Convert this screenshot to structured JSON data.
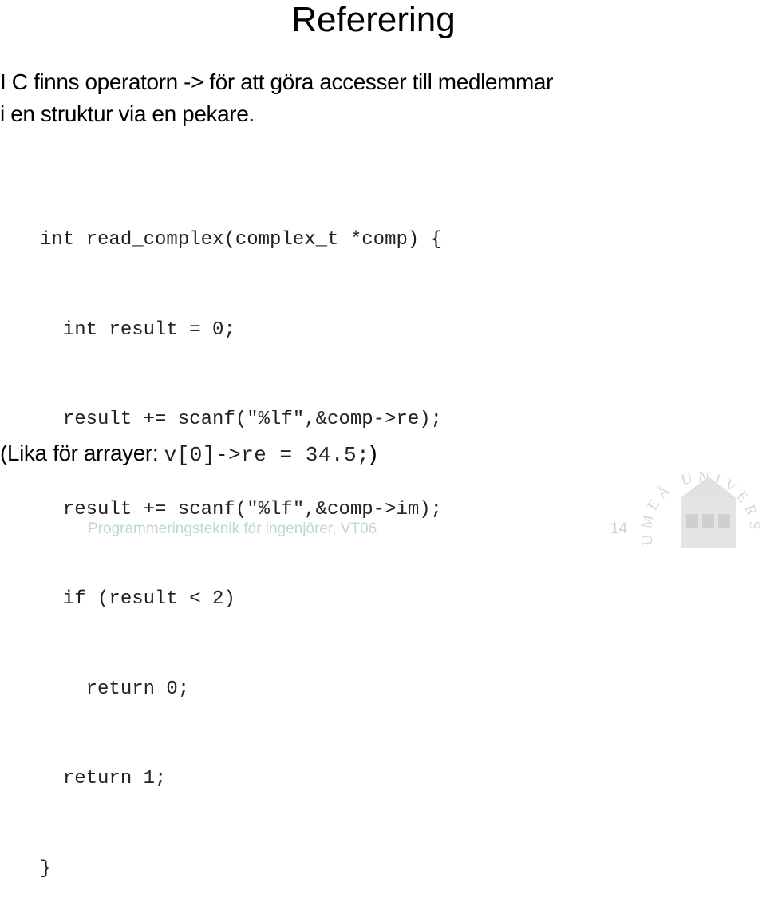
{
  "slide": {
    "title": "Referering",
    "intro_lines": [
      "I C finns operatorn -> för att göra accesser till medlemmar",
      "i en struktur via en pekare."
    ],
    "code_lines": [
      "int read_complex(complex_t *comp) {",
      "  int result = 0;",
      "  result += scanf(\"%lf\",&comp->re);",
      "  result += scanf(\"%lf\",&comp->im);",
      "  if (result < 2)",
      "    return 0;",
      "  return 1;",
      "}"
    ],
    "note": {
      "prefix": "(Lika för arrayer: ",
      "code": "v[0]->re = 34.5;",
      "suffix": ")"
    }
  },
  "footer": {
    "course": "Programmeringsteknik för ingenjörer, VT06",
    "page_number": "14"
  },
  "logo": {
    "icon": "university-seal-icon",
    "ring_text": "UMEÅ UNIVERSITET"
  },
  "colors": {
    "footer_text": "#bcd6dc",
    "logo_tint": "#d9d9d9"
  }
}
